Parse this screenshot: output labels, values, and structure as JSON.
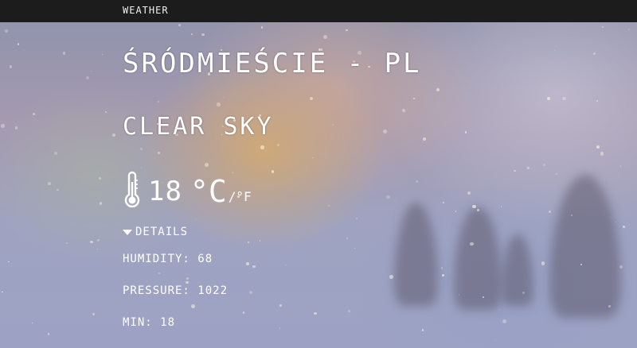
{
  "navbar": {
    "brand": "Weather"
  },
  "weather": {
    "location": "Śródmieście - PL",
    "condition": "Clear sky",
    "temperature": "18",
    "unit_primary": "°C",
    "unit_separator": "/",
    "unit_alternate": "°F",
    "details_label": "Details",
    "humidity": "Humidity: 68",
    "pressure": "Pressure: 1022",
    "min": "Min: 18"
  },
  "icons": {
    "thermometer": "thermometer-icon",
    "caret": "caret-down-icon"
  },
  "colors": {
    "navbar": "#1c1c1c",
    "text": "#ffffff"
  }
}
